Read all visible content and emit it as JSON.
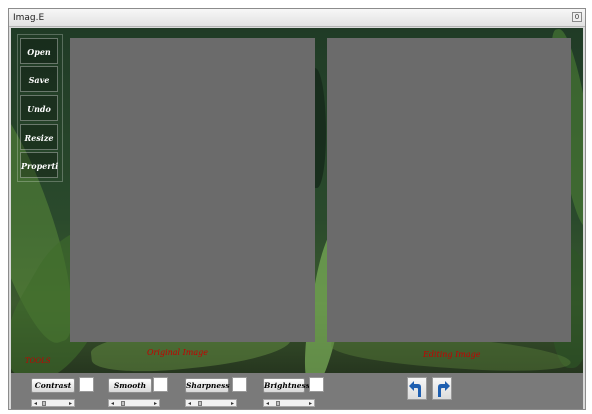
{
  "window": {
    "title": "Imag.E",
    "close_glyph": "0"
  },
  "tools": {
    "items": [
      {
        "name": "open",
        "label": "Open"
      },
      {
        "name": "save",
        "label": "Save"
      },
      {
        "name": "undo",
        "label": "Undo"
      },
      {
        "name": "resize",
        "label": "Resize"
      },
      {
        "name": "properties",
        "label": "Properti"
      }
    ],
    "section_label": "TOOLS"
  },
  "panels": {
    "original_caption": "Original Image",
    "editing_caption": "Editing Image"
  },
  "controls": {
    "contrast_label": "Contrast",
    "smooth_label": "Smooth",
    "sharpness_label": "Sharpness",
    "brightness_label": "Brightness"
  },
  "navigation": {
    "undo_icon": "undo-arrow-icon",
    "redo_icon": "redo-arrow-icon"
  },
  "colors": {
    "panel_gray": "#6b6b6b",
    "caption_red": "#c40000",
    "arrow_blue": "#1f5fb0"
  }
}
